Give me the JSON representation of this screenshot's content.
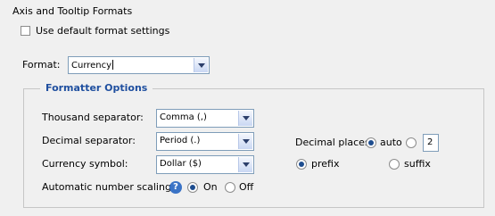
{
  "section_title": "Axis and Tooltip Formats",
  "use_default": {
    "label": "Use default format settings",
    "checked": false
  },
  "format": {
    "label": "Format:",
    "value": "Currency"
  },
  "formatter_options": {
    "legend": "Formatter Options",
    "thousand_separator": {
      "label": "Thousand separator:",
      "value": "Comma (,)"
    },
    "decimal_separator": {
      "label": "Decimal separator:",
      "value": "Period (.)"
    },
    "currency_symbol": {
      "label": "Currency symbol:",
      "value": "Dollar ($)"
    },
    "automatic_scaling": {
      "label": "Automatic number scaling",
      "on_label": "On",
      "off_label": "Off",
      "selected": "On"
    },
    "decimal_places": {
      "label": "Decimal places:",
      "auto_label": "auto",
      "value": "2",
      "selected": "auto"
    },
    "symbol_position": {
      "prefix_label": "prefix",
      "suffix_label": "suffix",
      "selected": "prefix"
    }
  }
}
